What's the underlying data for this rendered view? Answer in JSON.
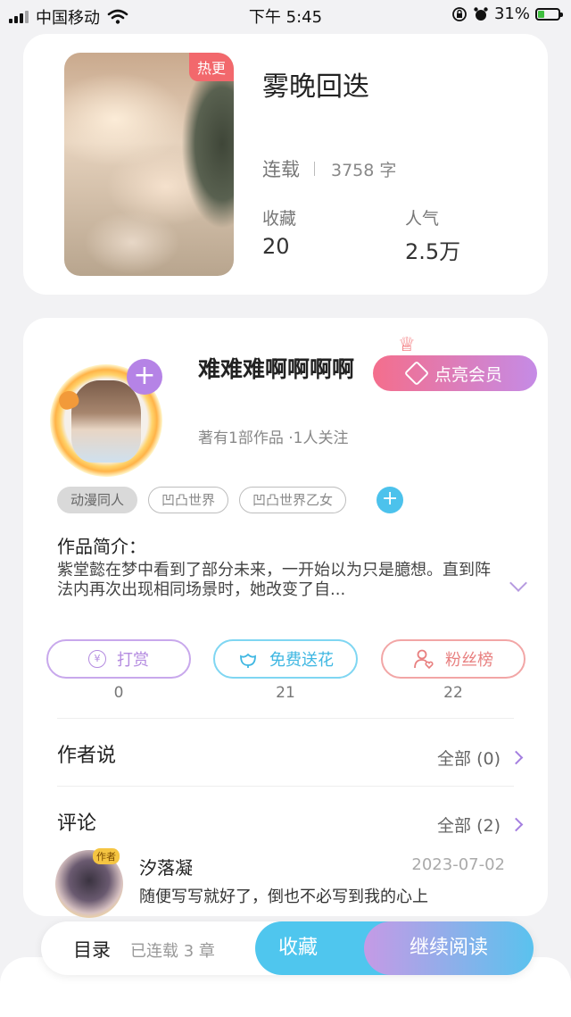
{
  "status_bar": {
    "carrier": "中国移动",
    "time": "下午 5:45",
    "battery": "31%",
    "battery_level": 0.31
  },
  "book": {
    "badge": "热更",
    "title": "雾晚回迭",
    "status": "连载",
    "words": "3758 字",
    "stats": [
      {
        "label": "收藏",
        "value": "20"
      },
      {
        "label": "人气",
        "value": "2.5万"
      }
    ]
  },
  "author": {
    "name": "难难难啊啊啊啊",
    "meta": "著有1部作品 ·1人关注",
    "follow_glyph": "+",
    "vip_label": "点亮会员",
    "vip_accent": "#f46e8c"
  },
  "tags": [
    "动漫同人",
    "凹凸世界",
    "凹凸世界乙女"
  ],
  "intro": {
    "title": "作品简介：",
    "text": "紫堂懿在梦中看到了部分未来，一开始以为只是臆想。直到阵法内再次出现相同场景时，她改变了自..."
  },
  "actions": [
    {
      "label": "打赏",
      "count": "0",
      "icon": "yuan-coin-icon",
      "color": "#b48be0"
    },
    {
      "label": "免费送花",
      "count": "21",
      "icon": "flower-icon",
      "color": "#4fc6ee"
    },
    {
      "label": "粉丝榜",
      "count": "22",
      "icon": "person-heart-icon",
      "color": "#f08a8a"
    }
  ],
  "author_says": {
    "title": "作者说",
    "all": "全部 (0)"
  },
  "comments": {
    "title": "评论",
    "all": "全部 (2)",
    "items": [
      {
        "badge": "作者",
        "name": "汐落凝",
        "date": "2023-07-02",
        "text": "随便写写就好了，倒也不必写到我的心上"
      }
    ]
  },
  "bottom_bar": {
    "toc": "目录",
    "chapters": "已连载 3 章",
    "collect": "收藏",
    "continue": "继续阅读"
  }
}
